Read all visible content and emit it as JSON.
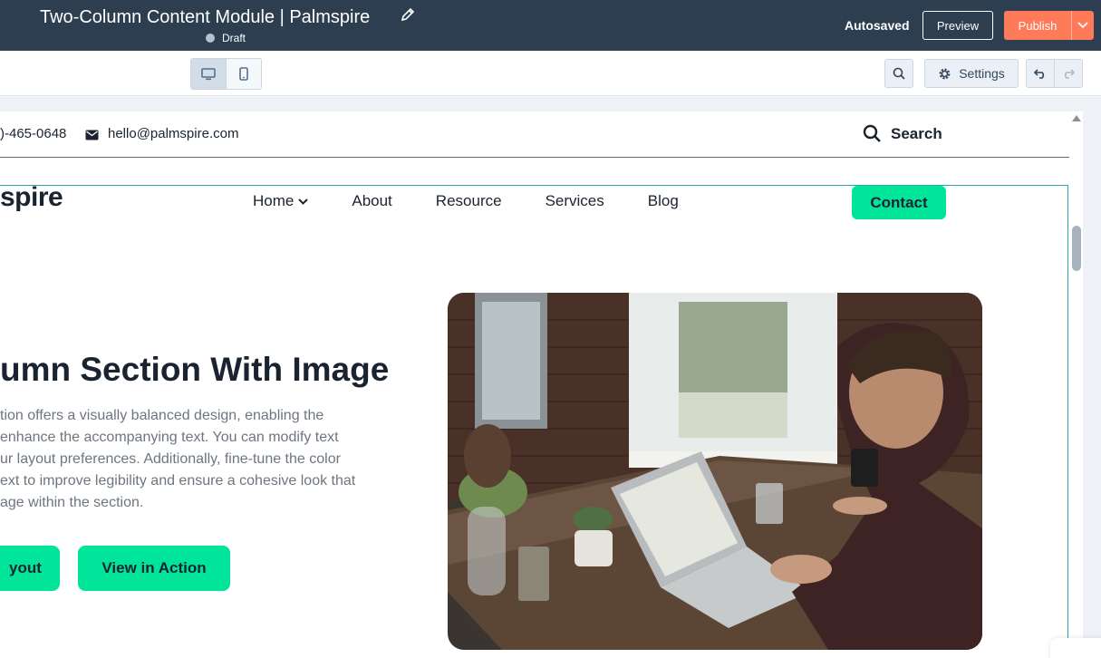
{
  "editor": {
    "title": "Two-Column Content Module | Palmspire",
    "status": "Draft",
    "autosaved": "Autosaved",
    "preview_label": "Preview",
    "publish_label": "Publish",
    "settings_label": "Settings"
  },
  "site": {
    "phone": ")-465-0648",
    "email": "hello@palmspire.com",
    "search_label": "Search",
    "logo": "spire",
    "nav": [
      "Home",
      "About",
      "Resource",
      "Services",
      "Blog"
    ],
    "contact_label": "Contact"
  },
  "hero": {
    "title": "umn Section With Image",
    "body_lines": [
      "tion offers a visually balanced design, enabling the",
      "enhance the accompanying text. You can modify text",
      "ur layout preferences. Additionally, fine-tune the color",
      "ext to improve legibility and ensure a cohesive look that",
      "age within the section."
    ],
    "cta_primary": "yout",
    "cta_secondary": "View in Action"
  },
  "colors": {
    "topbar": "#2d3e50",
    "publish": "#ff7a59",
    "accent": "#00e59a",
    "text_dark": "#1a2330",
    "selection": "#2aa7b5"
  },
  "icons": [
    "pencil-icon",
    "desktop-icon",
    "mobile-icon",
    "search-icon",
    "gear-icon",
    "undo-icon",
    "redo-icon",
    "mail-icon",
    "chevron-down-icon"
  ]
}
